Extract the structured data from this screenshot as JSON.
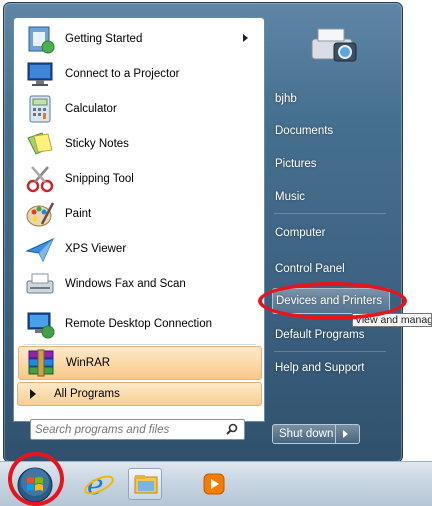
{
  "left_items": [
    {
      "label": "Getting Started",
      "icon": "getting-started-icon",
      "has_submenu": true
    },
    {
      "label": "Connect to a Projector",
      "icon": "projector-icon"
    },
    {
      "label": "Calculator",
      "icon": "calculator-icon"
    },
    {
      "label": "Sticky Notes",
      "icon": "sticky-notes-icon"
    },
    {
      "label": "Snipping Tool",
      "icon": "scissors-icon"
    },
    {
      "label": "Paint",
      "icon": "paint-palette-icon"
    },
    {
      "label": "XPS Viewer",
      "icon": "xps-viewer-icon"
    },
    {
      "label": "Windows Fax and Scan",
      "icon": "fax-icon"
    },
    {
      "label": "Remote Desktop Connection",
      "icon": "remote-desktop-icon"
    },
    {
      "label": "WinRAR",
      "icon": "winrar-icon",
      "highlighted": true
    }
  ],
  "all_programs_label": "All Programs",
  "search": {
    "placeholder": "Search programs and files"
  },
  "right_items": [
    {
      "label": "bjhb"
    },
    {
      "label": "Documents"
    },
    {
      "label": "Pictures"
    },
    {
      "label": "Music"
    },
    {
      "label": "Computer"
    },
    {
      "label": "Control Panel"
    },
    {
      "label": "Devices and Printers",
      "highlighted": true
    },
    {
      "label": "Default Programs"
    },
    {
      "label": "Help and Support"
    }
  ],
  "tooltip": "View and manage",
  "shutdown_label": "Shut down",
  "taskbar": [
    "start-orb-icon",
    "internet-explorer-icon",
    "windows-explorer-icon",
    "media-player-icon"
  ],
  "colors": {
    "accent_highlight": "#f8cf93",
    "annotation_red": "#e8141c",
    "menu_blue": "#46708f"
  }
}
